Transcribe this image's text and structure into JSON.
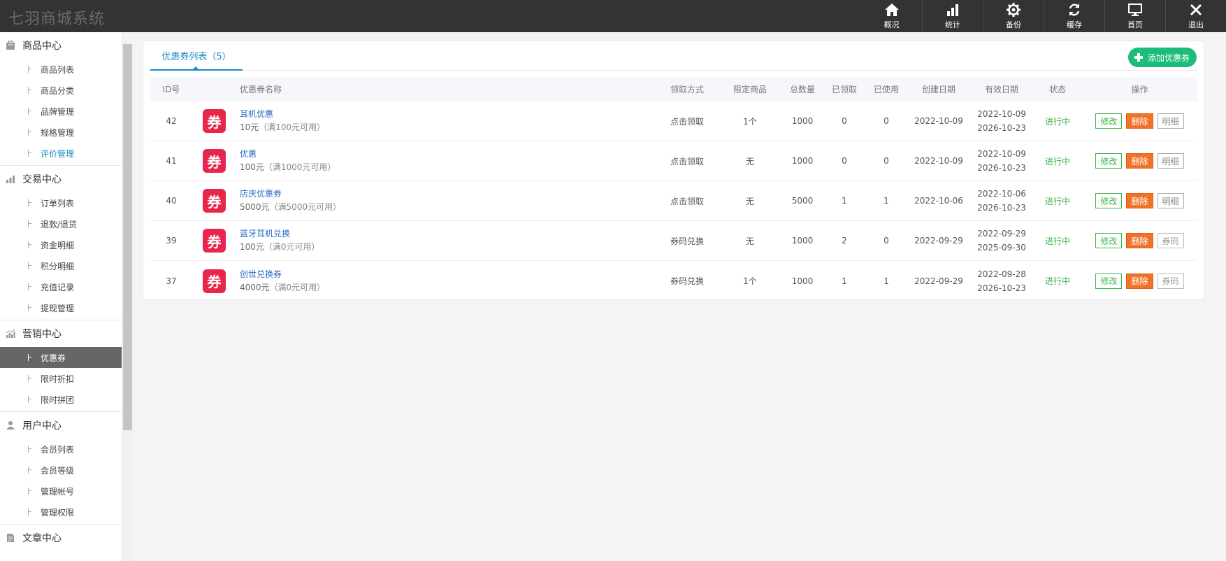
{
  "app": {
    "title": "七羽商城系统"
  },
  "topnav": [
    {
      "label": "概况",
      "icon": "home-icon"
    },
    {
      "label": "统计",
      "icon": "bar-chart-icon"
    },
    {
      "label": "备份",
      "icon": "gear-icon"
    },
    {
      "label": "缓存",
      "icon": "refresh-icon"
    },
    {
      "label": "首页",
      "icon": "monitor-icon"
    },
    {
      "label": "退出",
      "icon": "close-icon"
    }
  ],
  "sidebar": {
    "sections": [
      {
        "title": "商品中心",
        "icon": "shop-icon",
        "items": [
          "商品列表",
          "商品分类",
          "品牌管理",
          "规格管理",
          "评价管理"
        ]
      },
      {
        "title": "交易中心",
        "icon": "bars-icon",
        "items": [
          "订单列表",
          "退款/退货",
          "资金明细",
          "积分明细",
          "充值记录",
          "提现管理"
        ]
      },
      {
        "title": "营销中心",
        "icon": "marketing-icon",
        "items": [
          "优惠券",
          "限时折扣",
          "限时拼团"
        ]
      },
      {
        "title": "用户中心",
        "icon": "user-icon",
        "items": [
          "会员列表",
          "会员等级",
          "管理帐号",
          "管理权限"
        ]
      },
      {
        "title": "文章中心",
        "icon": "document-icon",
        "items": []
      }
    ],
    "highlighted_item": "评价管理",
    "active_item": "优惠券"
  },
  "main": {
    "tab_label": "优惠券列表（5）",
    "add_button_label": "添加优惠券",
    "columns": [
      "ID号",
      "优惠券名称",
      "领取方式",
      "限定商品",
      "总数量",
      "已领取",
      "已使用",
      "创建日期",
      "有效日期",
      "状态",
      "操作"
    ],
    "coupon_glyph": "券",
    "btn_edit": "修改",
    "btn_delete": "删除",
    "rows": [
      {
        "id": "42",
        "name": "耳机优惠",
        "amount": "10元",
        "note": "（满100元可用）",
        "way": "点击领取",
        "limit": "1个",
        "total": "1000",
        "received": "0",
        "used": "0",
        "created": "2022-10-09",
        "valid_from": "2022-10-09",
        "valid_to": "2026-10-23",
        "status": "进行中",
        "third_button": "明细"
      },
      {
        "id": "41",
        "name": "优惠",
        "amount": "100元",
        "note": "（满1000元可用）",
        "way": "点击领取",
        "limit": "无",
        "total": "1000",
        "received": "0",
        "used": "0",
        "created": "2022-10-09",
        "valid_from": "2022-10-09",
        "valid_to": "2026-10-23",
        "status": "进行中",
        "third_button": "明细"
      },
      {
        "id": "40",
        "name": "店庆优惠券",
        "amount": "5000元",
        "note": "（满5000元可用）",
        "way": "点击领取",
        "limit": "无",
        "total": "5000",
        "received": "1",
        "used": "1",
        "created": "2022-10-06",
        "valid_from": "2022-10-06",
        "valid_to": "2026-10-23",
        "status": "进行中",
        "third_button": "明细"
      },
      {
        "id": "39",
        "name": "蓝牙耳机兑换",
        "amount": "100元",
        "note": "（满0元可用）",
        "way": "券码兑换",
        "limit": "无",
        "total": "1000",
        "received": "2",
        "used": "0",
        "created": "2022-09-29",
        "valid_from": "2022-09-29",
        "valid_to": "2025-09-30",
        "status": "进行中",
        "third_button": "券码"
      },
      {
        "id": "37",
        "name": "创世兑换券",
        "amount": "4000元",
        "note": "（满0元可用）",
        "way": "券码兑换",
        "limit": "1个",
        "total": "1000",
        "received": "1",
        "used": "1",
        "created": "2022-09-29",
        "valid_from": "2022-09-28",
        "valid_to": "2026-10-23",
        "status": "进行中",
        "third_button": "券码"
      }
    ]
  },
  "colors": {
    "accent": "#1e88c9",
    "add_button": "#1bbd7a",
    "coupon_icon": "#e8264d",
    "status_active": "#3bb54a",
    "delete_button": "#f0732a",
    "topbar": "#333333"
  }
}
